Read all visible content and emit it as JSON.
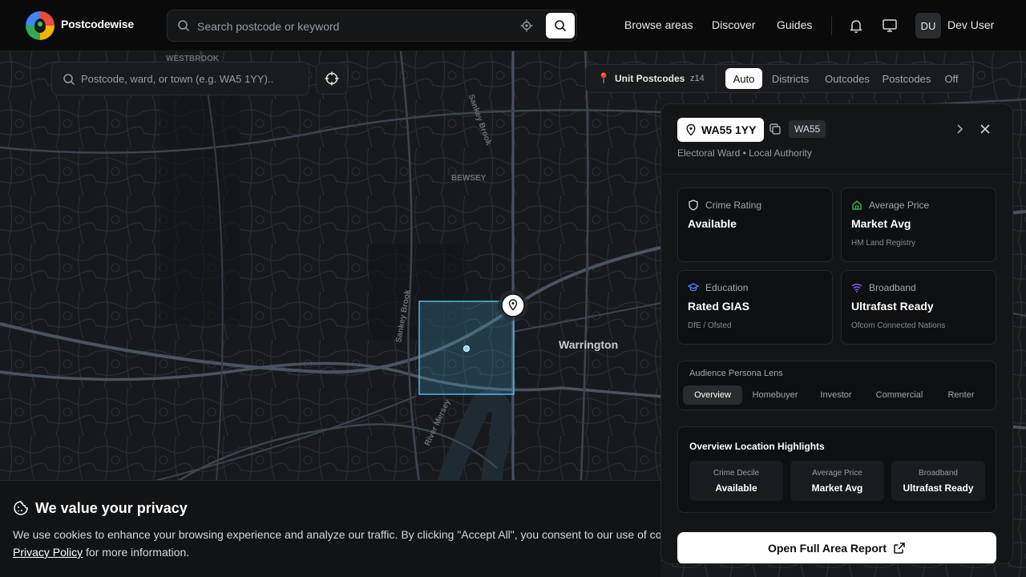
{
  "topbar": {
    "brand": "Postcodewise",
    "search_placeholder": "Search postcode or keyword",
    "nav": [
      "Browse areas",
      "Discover",
      "Guides"
    ],
    "avatar_initials": "DU",
    "user_name": "Dev User"
  },
  "map": {
    "search_placeholder": "Postcode, ward, or town (e.g. WA5 1YY)..",
    "layer_label": "Unit Postcodes",
    "zoom": "z14",
    "layer_modes": [
      "Auto",
      "Districts",
      "Outcodes",
      "Postcodes",
      "Off"
    ],
    "active_mode": "Auto",
    "labels": {
      "town": "Warrington",
      "area1": "BEWSEY",
      "area2": "WESTBROOK",
      "street1": "Sankey Brook",
      "street2": "Sankey Brook",
      "river": "River Mersey"
    }
  },
  "panel": {
    "postcode": "WA55 1YY",
    "district": "WA55",
    "subtitle": "Electoral Ward • Local Authority",
    "cards": [
      {
        "title": "Crime Rating",
        "value": "Available",
        "source": "",
        "icon": "shield-icon",
        "icon_color": "#d6d7db"
      },
      {
        "title": "Average Price",
        "value": "Market Avg",
        "source": "HM Land Registry",
        "icon": "home-icon",
        "icon_color": "#34c759"
      },
      {
        "title": "Education",
        "value": "Rated GIAS",
        "source": "DfE / Ofsted",
        "icon": "graduation-cap-icon",
        "icon_color": "#4f7dff"
      },
      {
        "title": "Broadband",
        "value": "Ultrafast Ready",
        "source": "Ofcom Connected Nations",
        "icon": "wifi-icon",
        "icon_color": "#8b5cf6"
      }
    ],
    "persona": {
      "title": "Audience Persona Lens",
      "tabs": [
        "Overview",
        "Homebuyer",
        "Investor",
        "Commercial",
        "Renter"
      ],
      "active": "Overview"
    },
    "highlights": {
      "title": "Overview Location Highlights",
      "items": [
        {
          "label": "Crime Decile",
          "value": "Available"
        },
        {
          "label": "Average Price",
          "value": "Market Avg"
        },
        {
          "label": "Broadband",
          "value": "Ultrafast Ready"
        }
      ]
    },
    "report_button": "Open Full Area Report"
  },
  "cookie": {
    "title": "We value your privacy",
    "body": "We use cookies to enhance your browsing experience and analyze our traffic. By clicking \"Accept All\", you consent to our use of cookies.",
    "link": "Privacy Policy",
    "tail": "for more information."
  },
  "colors": {
    "accent": "#4fb8e8",
    "background": "#0b0c0e"
  }
}
